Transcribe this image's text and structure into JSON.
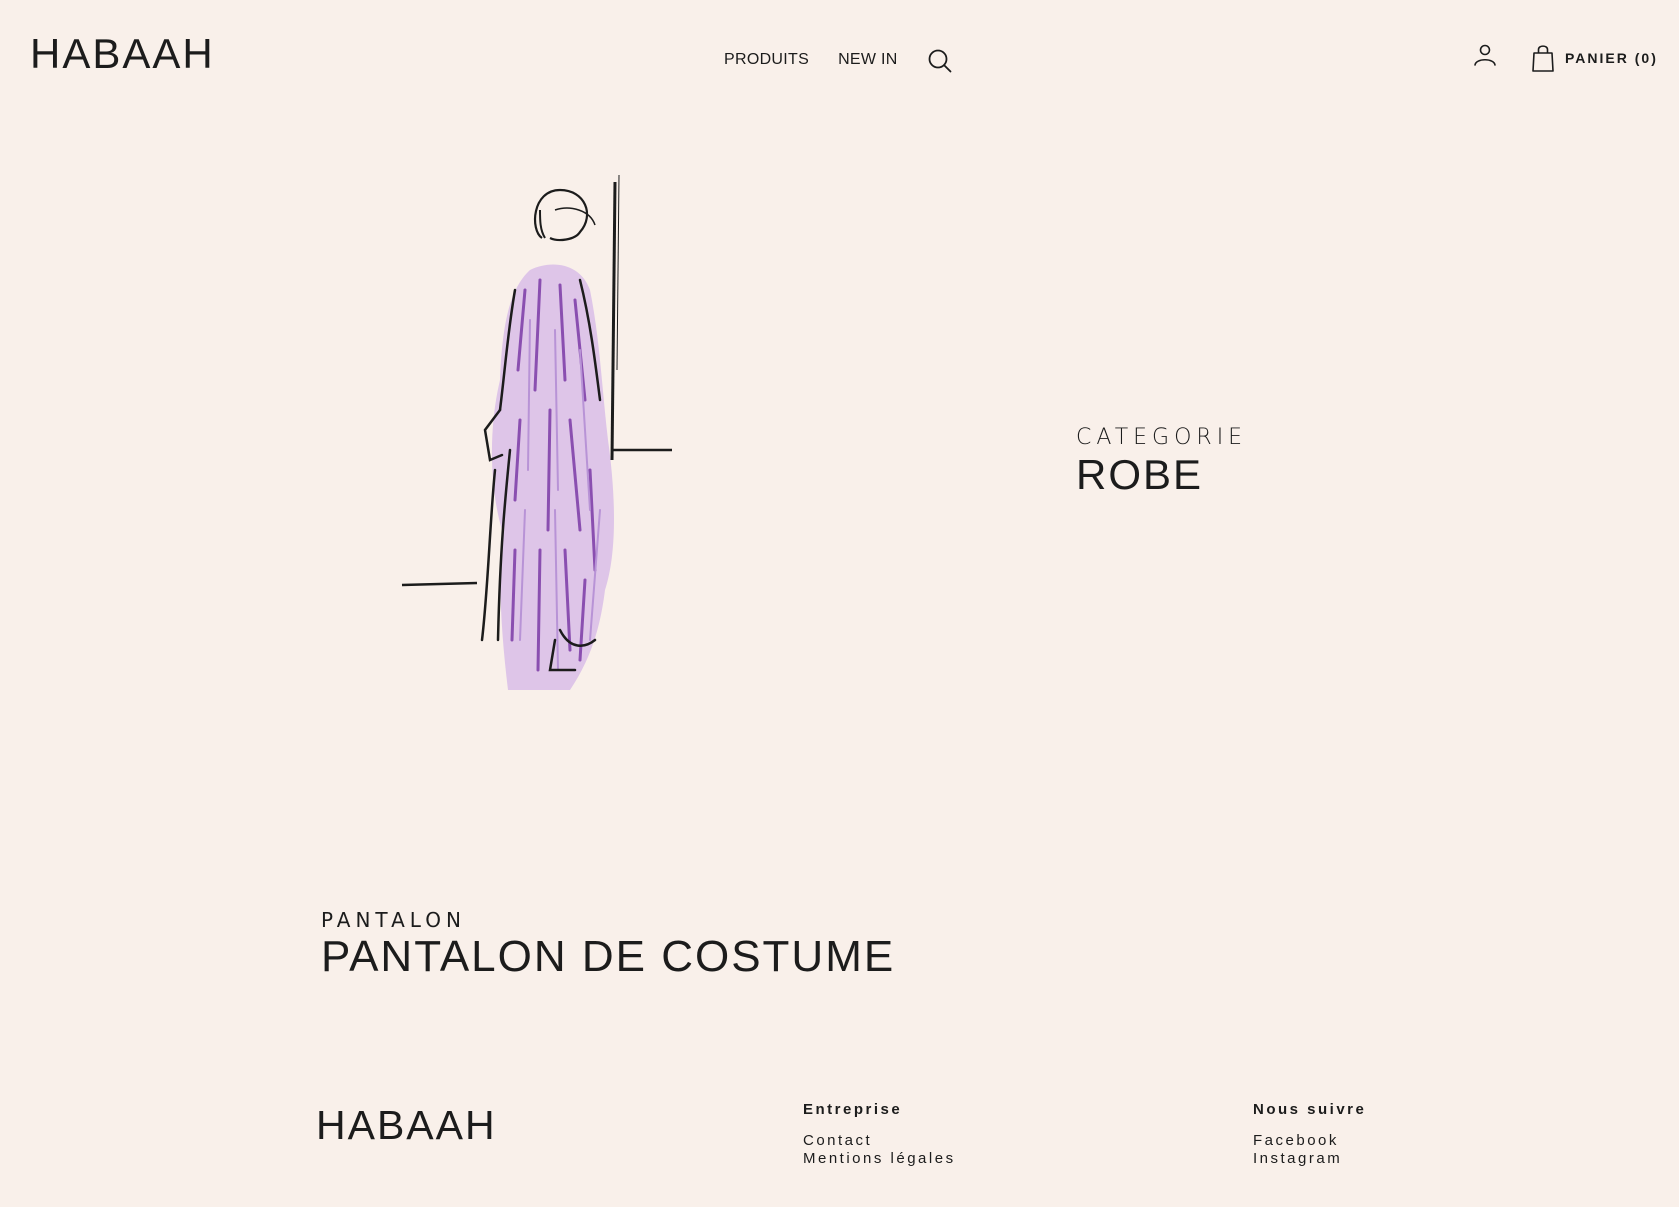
{
  "header": {
    "logo": "HABAAH",
    "nav": [
      "PRODUITS",
      "NEW IN"
    ],
    "search_icon": "search-icon",
    "account_icon": "user-icon",
    "cart_icon": "shopping-bag-icon",
    "cart_label": "PANIER (0)"
  },
  "category": {
    "kicker": "CATEGORIE",
    "title": "ROBE",
    "illustration": "fashion sketch of figure in purple robe",
    "accent_color": "#b18ad4"
  },
  "product": {
    "kicker": "PANTALON",
    "title": "PANTALON DE COSTUME"
  },
  "footer": {
    "logo": "HABAAH",
    "company": {
      "heading": "Entreprise",
      "links": [
        "Contact",
        "Mentions légales"
      ]
    },
    "social": {
      "heading": "Nous suivre",
      "links": [
        "Facebook",
        "Instagram"
      ]
    }
  },
  "colors": {
    "background": "#f9f0ea",
    "text": "#1c1c1c"
  }
}
